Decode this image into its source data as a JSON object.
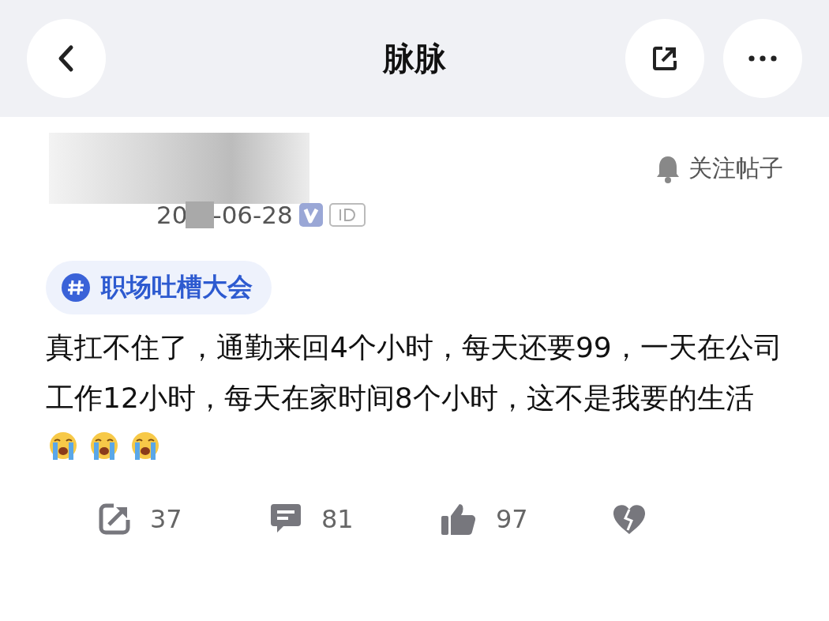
{
  "header": {
    "title": "脉脉"
  },
  "post": {
    "follow_label": "关注帖子",
    "date_prefix": "20",
    "date": "-06-28",
    "verified": true,
    "topic": "职场吐槽大会",
    "body": "真扛不住了，通勤来回4个小时，每天还要99，一天在公司工作12小时，每天在家时间8个小时，这不是我要的生活",
    "emoji": [
      {
        "kind": "crying"
      },
      {
        "kind": "crying"
      },
      {
        "kind": "crying"
      }
    ]
  },
  "actions": [
    {
      "kind": "share",
      "count": "37"
    },
    {
      "kind": "comment",
      "count": "81"
    },
    {
      "kind": "like",
      "count": "97"
    },
    {
      "kind": "dislike"
    }
  ]
}
